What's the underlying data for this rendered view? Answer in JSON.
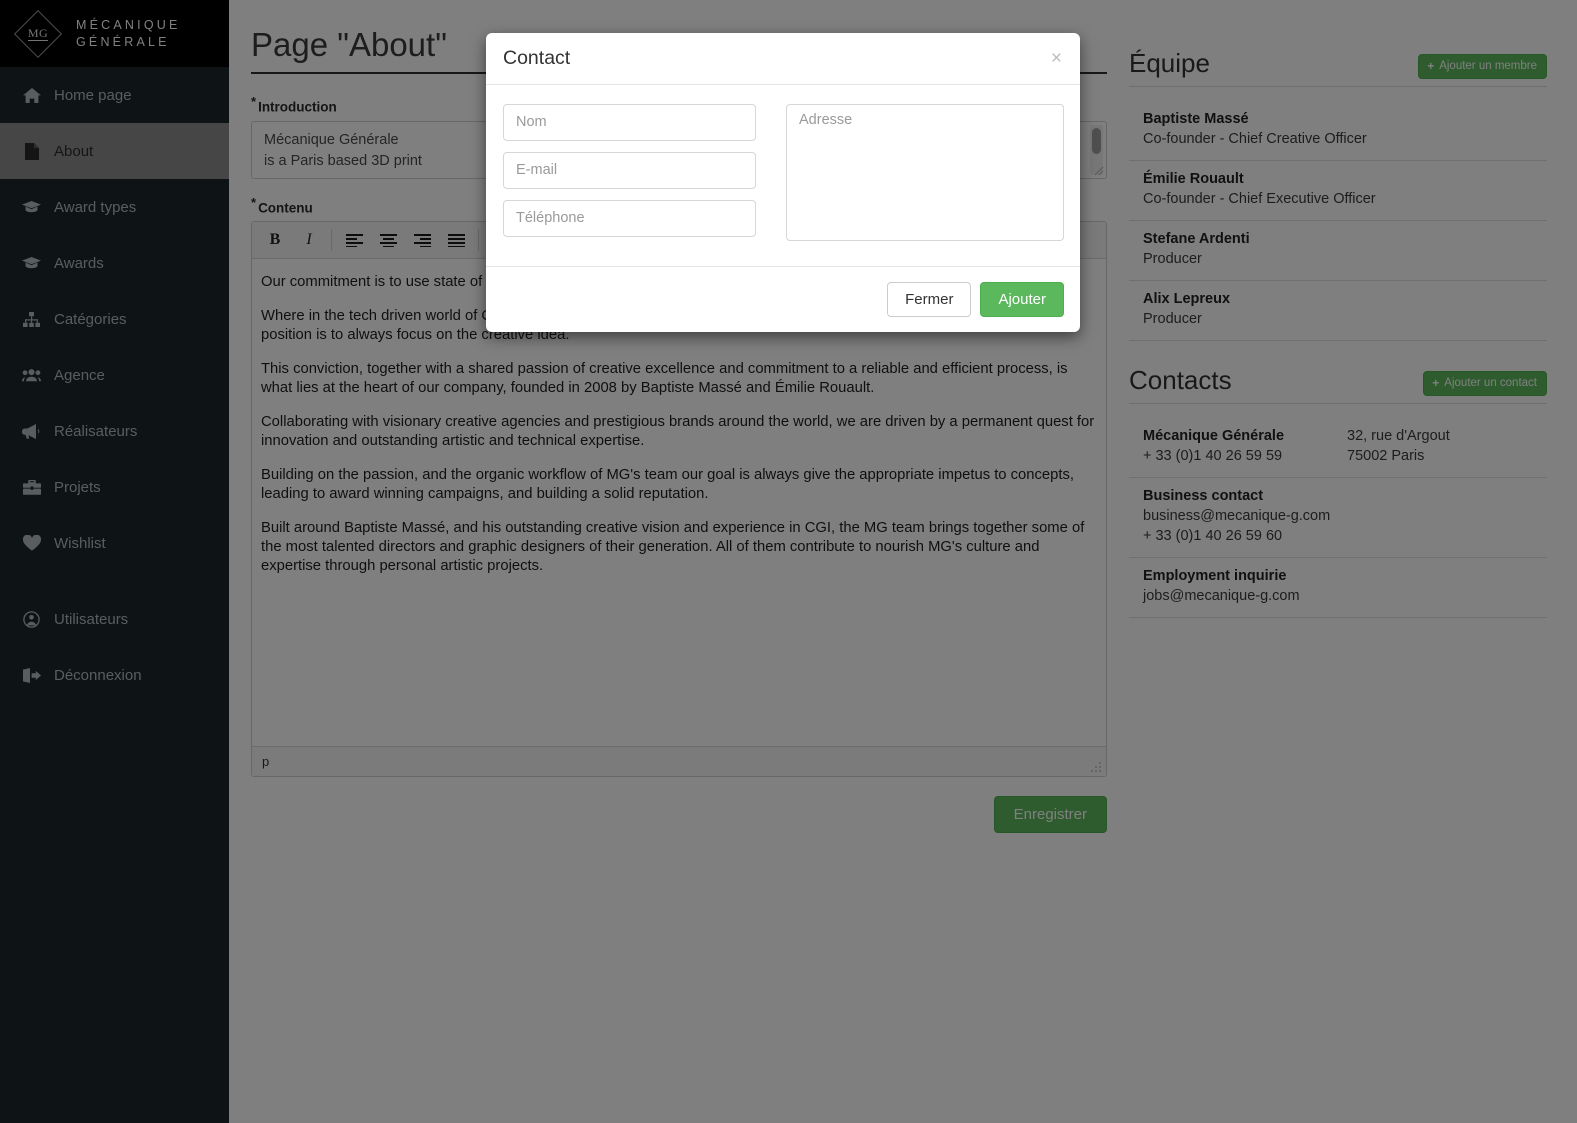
{
  "brand": {
    "mark_text": "MG",
    "line1": "MÉCANIQUE",
    "line2": "GÉNÉRALE"
  },
  "sidebar": {
    "items": [
      {
        "label": "Home page",
        "icon": "home-icon",
        "active": false
      },
      {
        "label": "About",
        "icon": "document-icon",
        "active": true
      },
      {
        "label": "Award types",
        "icon": "graduation-icon",
        "active": false
      },
      {
        "label": "Awards",
        "icon": "graduation-icon",
        "active": false
      },
      {
        "label": "Catégories",
        "icon": "sitemap-icon",
        "active": false
      },
      {
        "label": "Agence",
        "icon": "users-icon",
        "active": false
      },
      {
        "label": "Réalisateurs",
        "icon": "bullhorn-icon",
        "active": false
      },
      {
        "label": "Projets",
        "icon": "briefcase-icon",
        "active": false
      },
      {
        "label": "Wishlist",
        "icon": "heart-icon",
        "active": false
      },
      {
        "label": "Utilisateurs",
        "icon": "user-circle-icon",
        "active": false
      },
      {
        "label": "Déconnexion",
        "icon": "sign-out-icon",
        "active": false
      }
    ]
  },
  "main": {
    "page_title": "Page \"About\"",
    "introduction": {
      "label": "Introduction",
      "required_marker": "*",
      "value": "Mécanique Générale\nis a Paris based 3D print"
    },
    "contenu": {
      "label": "Contenu",
      "required_marker": "*",
      "toolbar": [
        {
          "name": "bold-button",
          "label": "B"
        },
        {
          "name": "italic-button",
          "label": "I"
        },
        {
          "name": "align-left-button",
          "label": ""
        },
        {
          "name": "align-center-button",
          "label": ""
        },
        {
          "name": "align-right-button",
          "label": ""
        },
        {
          "name": "align-justify-button",
          "label": ""
        }
      ],
      "paragraphs": [
        "Our commitment is to use state of the art technology to make ideas possible.",
        "Where in the tech driven world of CGI, machines and technical considerations do often take over the creative energy, our position is to always focus on the creative idea.",
        "This conviction, together with a shared passion of creative excellence and commitment to a reliable and efficient process, is what lies at the heart of our company, founded in 2008 by Baptiste Massé and Émilie Rouault.",
        "Collaborating with visionary creative agencies and prestigious brands around the world, we are driven by a permanent quest for innovation and outstanding artistic and technical expertise.",
        "Building on the passion, and the organic workflow of MG's team our goal is always give the appropriate impetus to concepts, leading to award winning campaigns, and building a solid reputation.",
        "Built around Baptiste Massé, and his outstanding creative vision and experience in CGI, the MG team brings together some of the most talented directors and graphic designers of their generation. All of them contribute to nourish MG's culture and expertise through personal artistic projects."
      ],
      "status_path": "p"
    },
    "save_label": "Enregistrer"
  },
  "equipe": {
    "title": "Équipe",
    "add_label": "Ajouter un membre",
    "add_icon": "plus-icon",
    "members": [
      {
        "name": "Baptiste Massé",
        "role": "Co-founder - Chief Creative Officer"
      },
      {
        "name": "Émilie Rouault",
        "role": "Co-founder - Chief Executive Officer"
      },
      {
        "name": "Stefane Ardenti",
        "role": "Producer"
      },
      {
        "name": "Alix Lepreux",
        "role": "Producer"
      }
    ]
  },
  "contacts": {
    "title": "Contacts",
    "add_label": "Ajouter un contact",
    "add_icon": "plus-icon",
    "entries": [
      {
        "name": "Mécanique Générale",
        "lines": [
          "+ 33 (0)1 40 26 59 59"
        ],
        "address": [
          "32, rue d'Argout",
          "75002 Paris"
        ]
      },
      {
        "name": "Business contact",
        "lines": [
          "business@mecanique-g.com",
          "+ 33 (0)1 40 26 59 60"
        ],
        "address": []
      },
      {
        "name": "Employment inquirie",
        "lines": [
          "jobs@mecanique-g.com"
        ],
        "address": []
      }
    ]
  },
  "modal": {
    "title": "Contact",
    "close_icon": "close-icon",
    "close_label": "×",
    "fields": {
      "nom": {
        "placeholder": "Nom",
        "value": ""
      },
      "email": {
        "placeholder": "E-mail",
        "value": ""
      },
      "telephone": {
        "placeholder": "Téléphone",
        "value": ""
      },
      "adresse": {
        "placeholder": "Adresse",
        "value": ""
      }
    },
    "close_button": "Fermer",
    "submit_button": "Ajouter"
  },
  "colors": {
    "sidebar_bg": "#1d272c",
    "brand_bg": "#000000",
    "active_item": "#8d8d8d",
    "green": "#5cb85c",
    "overlay": "rgba(0,0,0,0.5)"
  }
}
